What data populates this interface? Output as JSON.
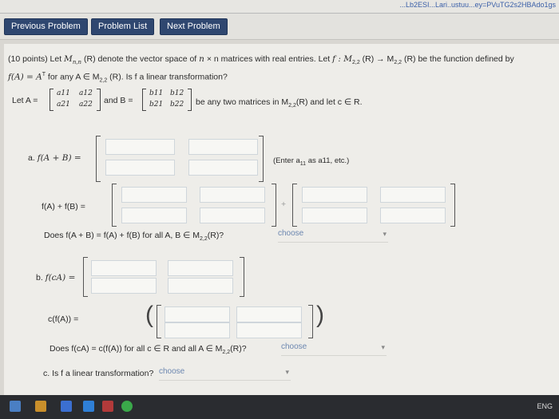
{
  "browser": {
    "url": "...Lb2ESI...Lari..ustuu...ey=PVuTG2s2HBAdo1gs"
  },
  "nav": {
    "prev": "Previous Problem",
    "list": "Problem List",
    "next": "Next Problem"
  },
  "problem": {
    "points": "(10 points) Let",
    "M_nR": "M",
    "intro_a": "(R) denote the vector space of",
    "intro_b": "× n matrices with real entries. Let",
    "func_def": "f : M",
    "intro_c": "(R) → M",
    "intro_d": "(R) be the function defined by",
    "line2": "f(A) = A",
    "line2b": "for any A ∈ M",
    "line2c": "(R). Is f a linear transformation?",
    "letA": "Let A =",
    "andB": "and B =",
    "anyTwo": "be any two matrices in M",
    "anyTwoEnd": "(R) and let c ∈ R.",
    "A": [
      "a11",
      "a12",
      "a21",
      "a22"
    ],
    "B": [
      "b11",
      "b12",
      "b21",
      "b22"
    ]
  },
  "parts": {
    "a_label": "a.",
    "a_expr": "f(A + B) =",
    "a_hint": "(Enter a",
    "a_hint2": "as a11, etc.)",
    "sum_expr": "f(A) + f(B) =",
    "plus": "+",
    "does_a": "Does f(A + B) = f(A) + f(B) for all A, B ∈ M",
    "does_a2": "(R)?",
    "choose": "choose",
    "b_label": "b.",
    "b_expr": "f(cA) =",
    "cfa_expr": "c(f(A)) =",
    "does_b": "Does f(cA) = c(f(A)) for all c ∈ R and all A ∈ M",
    "does_b2": "(R)?",
    "c_label": "c. Is f a linear transformation?"
  },
  "taskbar": {
    "locale": "ENG"
  }
}
